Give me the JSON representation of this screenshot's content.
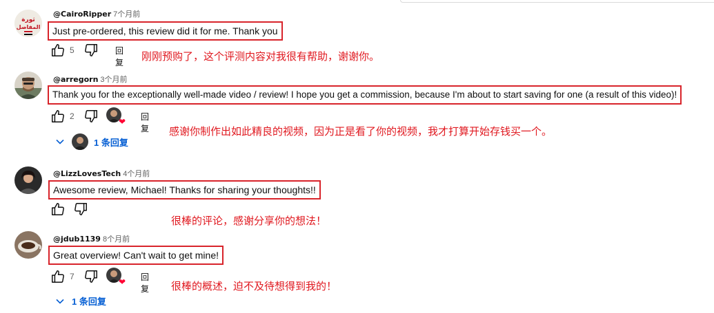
{
  "comments": [
    {
      "handle": "@CairoRipper",
      "time": "7个月前",
      "text": "Just pre-ordered, this review did it for me. Thank you",
      "likes": "5",
      "reply_label": "回复",
      "translation": "刚刚预购了，这个评测内容对我很有帮助，谢谢你。",
      "avatar_text": "ثورة المفاصل"
    },
    {
      "handle": "@arregorn",
      "time": "3个月前",
      "text": "Thank you for the exceptionally well-made video / review! I hope you get a commission, because I'm about to start saving for one (a result of this video)!",
      "likes": "2",
      "reply_label": "回复",
      "translation": "感谢你制作出如此精良的视频，因为正是看了你的视频，我才打算开始存钱买一个。",
      "replies_label": "1 条回复"
    },
    {
      "handle": "@LizzLovesTech",
      "time": "4个月前",
      "text": "Awesome review, Michael! Thanks for sharing your thoughts!!",
      "translation": "很棒的评论，感谢分享你的想法！"
    },
    {
      "handle": "@jdub1139",
      "time": "8个月前",
      "text": "Great overview!  Can't wait to get mine!",
      "likes": "7",
      "reply_label": "回复",
      "translation": "很棒的概述，迫不及待想得到我的！",
      "replies_label": "1 条回复"
    }
  ],
  "colors": {
    "annotation_red": "#e0181f",
    "box_border": "#d8232a",
    "link_blue": "#065fd4",
    "heart": "#ff0033"
  }
}
